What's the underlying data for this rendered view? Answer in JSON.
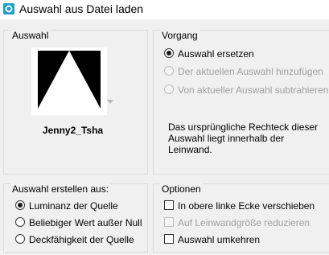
{
  "window": {
    "title": "Auswahl aus Datei laden",
    "icon": "app-icon"
  },
  "auswahl": {
    "title": "Auswahl",
    "preview_name": "Jenny2_Tsha"
  },
  "vorgang": {
    "title": "Vorgang",
    "options": [
      {
        "label": "Auswahl ersetzen",
        "selected": true,
        "enabled": true
      },
      {
        "label": "Der aktuellen Auswahl hinzufügen",
        "selected": false,
        "enabled": false
      },
      {
        "label": "Von aktueller Auswahl subtrahieren",
        "selected": false,
        "enabled": false
      }
    ],
    "note": "Das ursprüngliche Rechteck dieser Auswahl liegt innerhalb der Leinwand."
  },
  "erstellen": {
    "title": "Auswahl erstellen aus:",
    "options": [
      {
        "label": "Luminanz der Quelle",
        "selected": true
      },
      {
        "label": "Beliebiger Wert außer Null",
        "selected": false
      },
      {
        "label": "Deckfähigkeit der Quelle",
        "selected": false
      }
    ]
  },
  "optionen": {
    "title": "Optionen",
    "items": [
      {
        "label": "In obere linke Ecke verschieben",
        "checked": false,
        "enabled": true
      },
      {
        "label": "Auf Leinwandgröße reduzieren",
        "checked": false,
        "enabled": false
      },
      {
        "label": "Auswahl umkehren",
        "checked": false,
        "enabled": true
      }
    ]
  },
  "colors": {
    "accent": "#1aa0c8",
    "border": "#dcdcdc",
    "disabled": "#a0a0a0"
  }
}
